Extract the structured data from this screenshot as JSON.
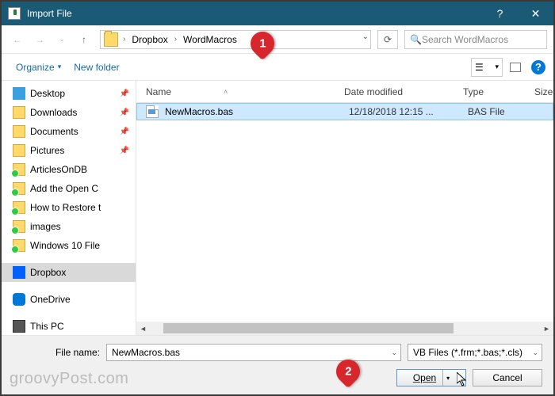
{
  "title": "Import File",
  "breadcrumb": {
    "seg1": "Dropbox",
    "seg2": "WordMacros"
  },
  "search": {
    "placeholder": "Search WordMacros"
  },
  "toolbar": {
    "organize": "Organize",
    "newfolder": "New folder"
  },
  "tree": {
    "items": [
      {
        "label": "Desktop",
        "icon": "desktop",
        "pin": true
      },
      {
        "label": "Downloads",
        "icon": "folder",
        "pin": true
      },
      {
        "label": "Documents",
        "icon": "folder",
        "pin": true
      },
      {
        "label": "Pictures",
        "icon": "folder",
        "pin": true
      },
      {
        "label": "ArticlesOnDB",
        "icon": "folder green",
        "pin": false
      },
      {
        "label": "Add the Open C",
        "icon": "folder green",
        "pin": false
      },
      {
        "label": "How to Restore t",
        "icon": "folder green",
        "pin": false
      },
      {
        "label": "images",
        "icon": "folder green",
        "pin": false
      },
      {
        "label": "Windows 10 File",
        "icon": "folder green",
        "pin": false
      }
    ],
    "dropbox": "Dropbox",
    "onedrive": "OneDrive",
    "thispc": "This PC"
  },
  "columns": {
    "name": "Name",
    "date": "Date modified",
    "type": "Type",
    "size": "Size"
  },
  "file": {
    "name": "NewMacros.bas",
    "date": "12/18/2018 12:15 ...",
    "type": "BAS File"
  },
  "footer": {
    "label": "File name:",
    "value": "NewMacros.bas",
    "filter": "VB Files (*.frm;*.bas;*.cls)",
    "open": "Open",
    "cancel": "Cancel"
  },
  "watermark": "groovyPost.com",
  "callouts": {
    "c1": "1",
    "c2": "2"
  }
}
